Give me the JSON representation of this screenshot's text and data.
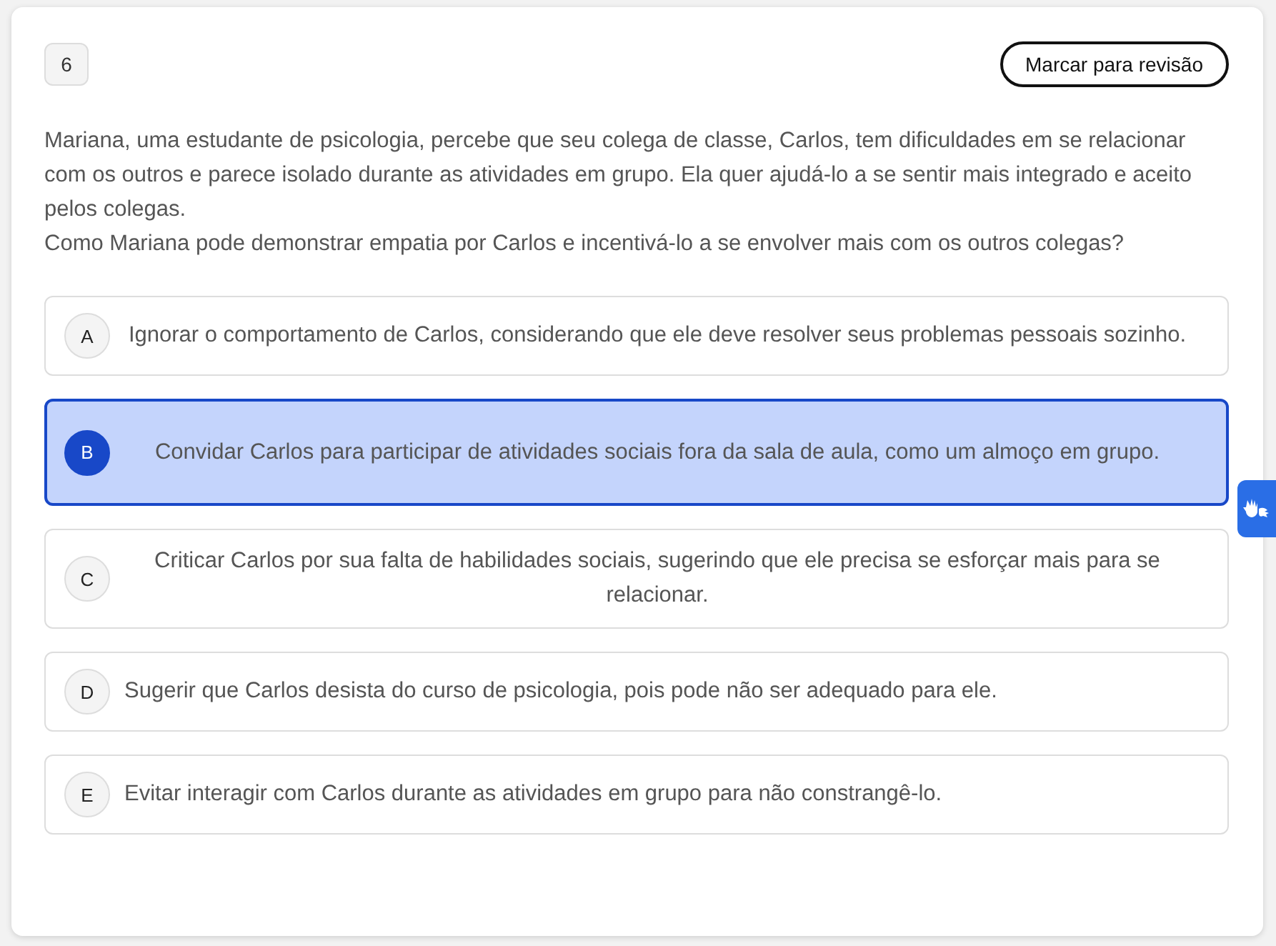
{
  "question": {
    "number": "6",
    "review_button": "Marcar para revisão",
    "paragraphs": [
      "Mariana, uma estudante de psicologia, percebe que seu colega de classe, Carlos, tem dificuldades em se relacionar com os outros e parece isolado durante as atividades em grupo. Ela quer ajudá-lo a se sentir mais integrado e aceito pelos colegas.",
      "Como Mariana pode demonstrar empatia por Carlos e incentivá-lo a se envolver mais com os outros colegas?"
    ]
  },
  "options": [
    {
      "letter": "A",
      "text": "Ignorar o comportamento de Carlos, considerando que ele deve resolver seus problemas pessoais sozinho.",
      "selected": false
    },
    {
      "letter": "B",
      "text": "Convidar Carlos para participar de atividades sociais fora da sala de aula, como um almoço em grupo.",
      "selected": true
    },
    {
      "letter": "C",
      "text": "Criticar Carlos por sua falta de habilidades sociais, sugerindo que ele precisa se esforçar mais para se relacionar.",
      "selected": false
    },
    {
      "letter": "D",
      "text": "Sugerir que Carlos desista do curso de psicologia, pois pode não ser adequado para ele.",
      "selected": false
    },
    {
      "letter": "E",
      "text": "Evitar interagir com Carlos durante as atividades em grupo para não constrangê-lo.",
      "selected": false
    }
  ]
}
